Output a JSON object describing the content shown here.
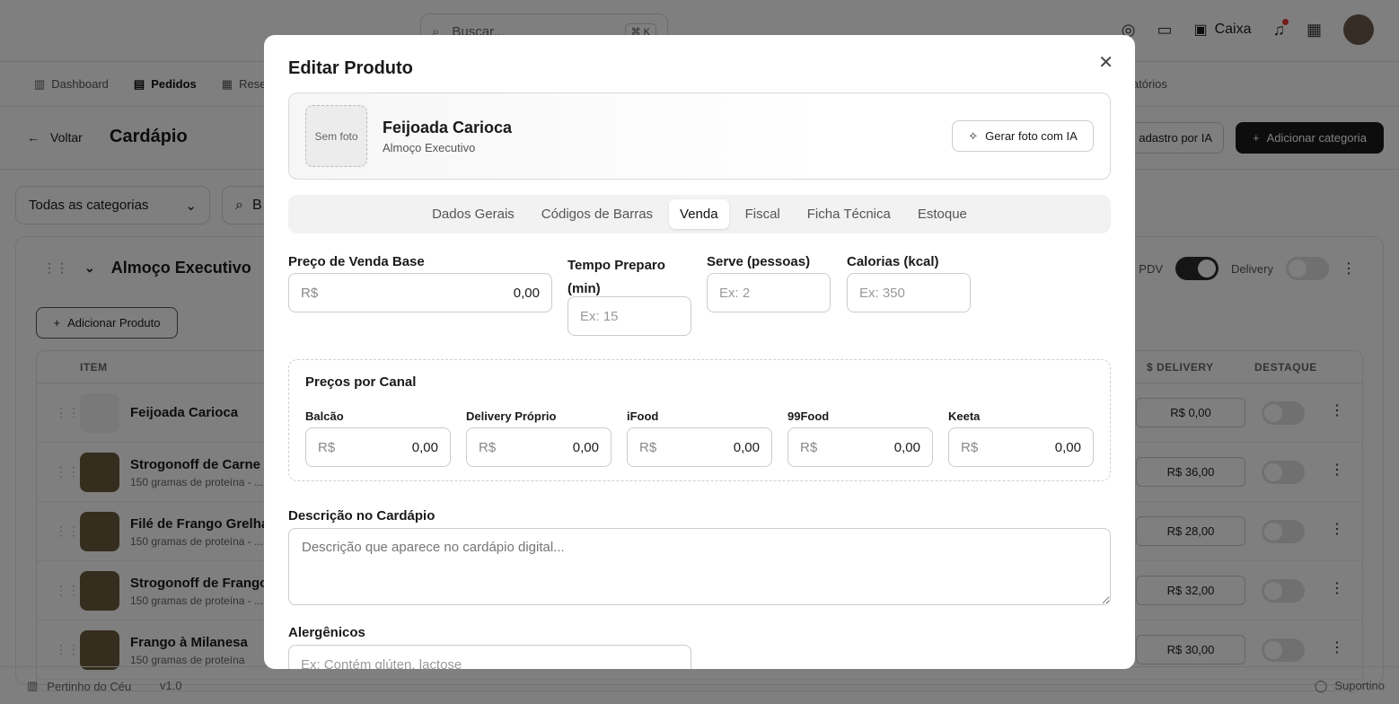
{
  "topbar": {
    "search_placeholder": "Buscar...",
    "search_shortcut": "⌘ K",
    "caixa_label": "Caixa"
  },
  "nav": {
    "items": [
      {
        "label": "Dashboard",
        "icon": "building-icon"
      },
      {
        "label": "Pedidos",
        "icon": "clipboard-icon",
        "active": true
      },
      {
        "label": "Rese",
        "icon": "calendar-icon"
      }
    ],
    "right_fragment": "latórios"
  },
  "page": {
    "back_label": "Voltar",
    "title": "Cardápio",
    "ia_fragment": "adastro por IA",
    "add_category_label": "Adicionar categoria"
  },
  "filters": {
    "category_value": "Todas as categorias",
    "search_fragment": "B"
  },
  "category": {
    "name": "Almoço Executivo",
    "pdv_label": "PDV",
    "delivery_label": "Delivery",
    "add_product_label": "Adicionar Produto",
    "columns": {
      "item": "ITEM",
      "delivery": "$ DELIVERY",
      "destaque": "DESTAQUE"
    },
    "rows": [
      {
        "name": "Feijoada Carioca",
        "sub": "",
        "price": "R$ 0,00"
      },
      {
        "name": "Strogonoff de Carne",
        "sub": "150 gramas de proteína - ...",
        "price": "R$ 36,00"
      },
      {
        "name": "Filé de Frango Grelhad",
        "sub": "150 gramas de proteína - ...",
        "price": "R$ 28,00"
      },
      {
        "name": "Strogonoff de Frango",
        "sub": "150 gramas de proteína - ...",
        "price": "R$ 32,00"
      },
      {
        "name": "Frango à Milanesa",
        "sub": "150 gramas de proteína",
        "price": "R$ 30,00"
      }
    ]
  },
  "footer": {
    "brand": "Pertinho do Céu",
    "version": "v1.0",
    "support": "Suportino"
  },
  "modal": {
    "title": "Editar Produto",
    "product": {
      "photo_placeholder": "Sem foto",
      "name": "Feijoada Carioca",
      "category": "Almoço Executivo",
      "generate_photo_label": "Gerar foto com IA"
    },
    "tabs": [
      {
        "label": "Dados Gerais"
      },
      {
        "label": "Códigos de Barras"
      },
      {
        "label": "Venda",
        "active": true
      },
      {
        "label": "Fiscal"
      },
      {
        "label": "Ficha Técnica"
      },
      {
        "label": "Estoque"
      }
    ],
    "fields": {
      "base_price": {
        "label": "Preço de Venda Base",
        "currency": "R$",
        "value": "0,00"
      },
      "prep_time": {
        "label_line1": "Tempo Preparo",
        "label_line2": "(min)",
        "placeholder": "Ex: 15"
      },
      "serves": {
        "label": "Serve (pessoas)",
        "placeholder": "Ex: 2"
      },
      "calories": {
        "label": "Calorias (kcal)",
        "placeholder": "Ex: 350"
      }
    },
    "channels": {
      "title": "Preços por Canal",
      "items": [
        {
          "label": "Balcão",
          "currency": "R$",
          "value": "0,00"
        },
        {
          "label": "Delivery Próprio",
          "currency": "R$",
          "value": "0,00"
        },
        {
          "label": "iFood",
          "currency": "R$",
          "value": "0,00"
        },
        {
          "label": "99Food",
          "currency": "R$",
          "value": "0,00"
        },
        {
          "label": "Keeta",
          "currency": "R$",
          "value": "0,00"
        }
      ]
    },
    "description": {
      "label": "Descrição no Cardápio",
      "placeholder": "Descrição que aparece no cardápio digital..."
    },
    "allergens": {
      "label": "Alergênicos",
      "placeholder": "Ex: Contém glúten, lactose"
    }
  }
}
